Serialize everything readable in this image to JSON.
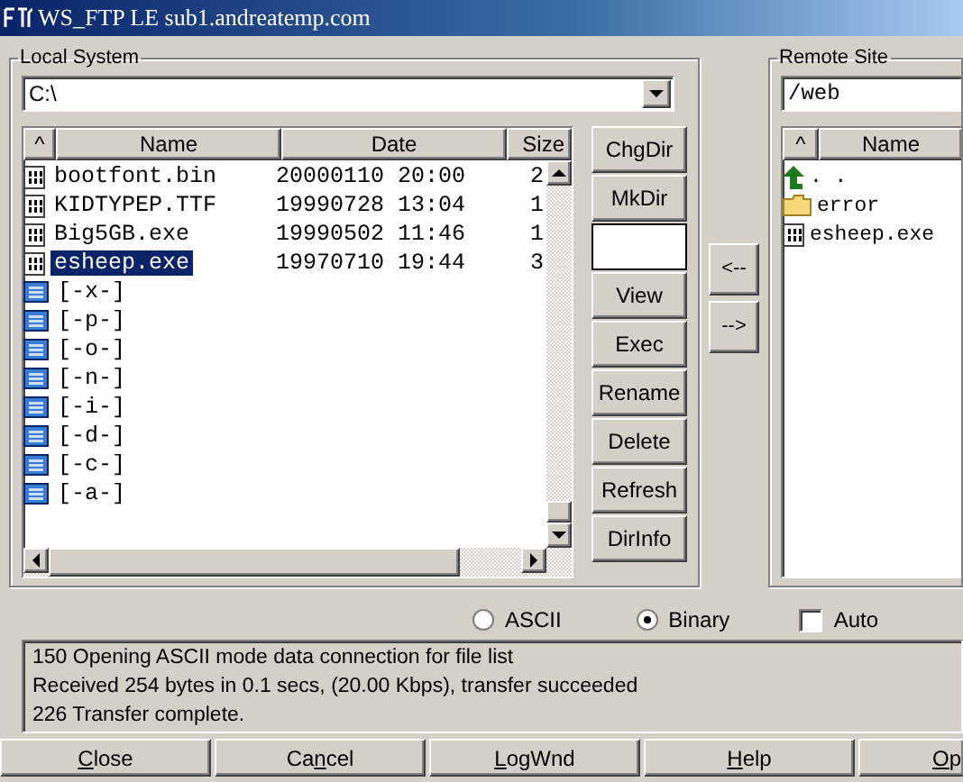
{
  "window": {
    "title": "WS_FTP LE sub1.andreatemp.com"
  },
  "local": {
    "legend": "Local System",
    "path": "C:\\",
    "columns": [
      "^",
      "Name",
      "Date",
      "Size"
    ],
    "rows": [
      {
        "kind": "file",
        "name": "bootfont.bin",
        "date": "20000110 20:00",
        "size": "2",
        "selected": false
      },
      {
        "kind": "file",
        "name": "KIDTYPEP.TTF",
        "date": "19990728 13:04",
        "size": "1",
        "selected": false
      },
      {
        "kind": "file",
        "name": "Big5GB.exe",
        "date": "19990502 11:46",
        "size": "1",
        "selected": false
      },
      {
        "kind": "file",
        "name": "esheep.exe",
        "date": "19970710 19:44",
        "size": "3",
        "selected": true
      },
      {
        "kind": "drive",
        "name": "[-x-]",
        "selected": false
      },
      {
        "kind": "drive",
        "name": "[-p-]",
        "selected": false
      },
      {
        "kind": "drive",
        "name": "[-o-]",
        "selected": false
      },
      {
        "kind": "drive",
        "name": "[-n-]",
        "selected": false
      },
      {
        "kind": "drive",
        "name": "[-i-]",
        "selected": false
      },
      {
        "kind": "drive",
        "name": "[-d-]",
        "selected": false
      },
      {
        "kind": "drive",
        "name": "[-c-]",
        "selected": false
      },
      {
        "kind": "drive",
        "name": "[-a-]",
        "selected": false
      }
    ],
    "actions": [
      {
        "kind": "button",
        "label": "ChgDir"
      },
      {
        "kind": "button",
        "label": "MkDir"
      },
      {
        "kind": "field"
      },
      {
        "kind": "button",
        "label": "View"
      },
      {
        "kind": "button",
        "label": "Exec"
      },
      {
        "kind": "button",
        "label": "Rename"
      },
      {
        "kind": "button",
        "label": "Delete"
      },
      {
        "kind": "button",
        "label": "Refresh"
      },
      {
        "kind": "button",
        "label": "DirInfo"
      }
    ]
  },
  "transfer_buttons": [
    "<--",
    "-->"
  ],
  "remote": {
    "legend": "Remote Site",
    "path": "/web",
    "columns": [
      "^",
      "Name"
    ],
    "rows": [
      {
        "kind": "up",
        "name": ". ."
      },
      {
        "kind": "folder",
        "name": "error"
      },
      {
        "kind": "file",
        "name": "esheep.exe"
      }
    ]
  },
  "modes": [
    {
      "kind": "radio",
      "label": "ASCII",
      "selected": false
    },
    {
      "kind": "radio",
      "label": "Binary",
      "selected": true
    },
    {
      "kind": "checkbox",
      "label": "Auto",
      "checked": false
    }
  ],
  "log": [
    "150 Opening ASCII mode data connection for file list",
    "Received 254 bytes in 0.1 secs, (20.00 Kbps), transfer succeeded",
    "226 Transfer complete."
  ],
  "buttons": [
    {
      "key": "C",
      "after": "lose"
    },
    {
      "before": "Ca",
      "key": "n",
      "after": "cel"
    },
    {
      "key": "L",
      "after": "ogWnd"
    },
    {
      "key": "H",
      "after": "elp"
    },
    {
      "key": "O",
      "after": "p"
    }
  ]
}
